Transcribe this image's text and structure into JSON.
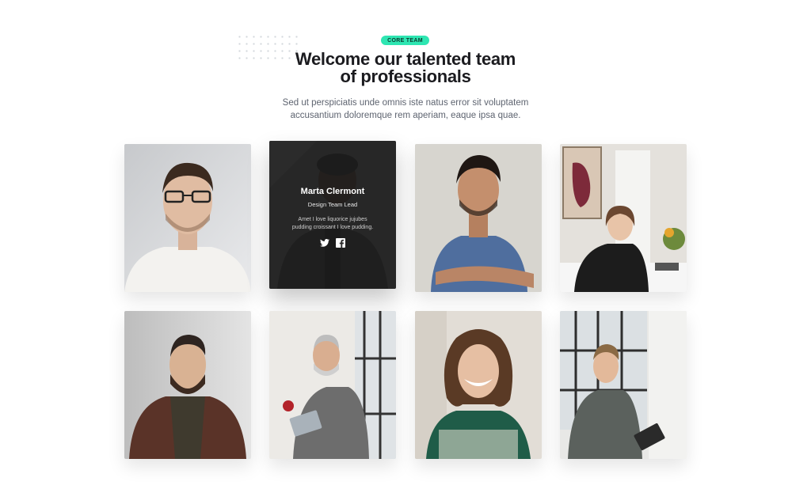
{
  "header": {
    "badge": "CORE TEAM",
    "title_line1": "Welcome our talented team",
    "title_line2": "of professionals",
    "subtitle_line1": "Sed ut perspiciatis unde omnis iste natus error sit voluptatem",
    "subtitle_line2": "accusantium doloremque rem aperiam, eaque ipsa quae."
  },
  "featured_member": {
    "name": "Marta Clermont",
    "role": "Design Team Lead",
    "bio_line1": "Amet I love liquorice jujubes",
    "bio_line2": "pudding croissant I love pudding.",
    "social": [
      "twitter-icon",
      "facebook-icon"
    ]
  },
  "colors": {
    "accent": "#2ee6b2",
    "heading": "#1b1b1f",
    "body_text": "#5e6470"
  }
}
